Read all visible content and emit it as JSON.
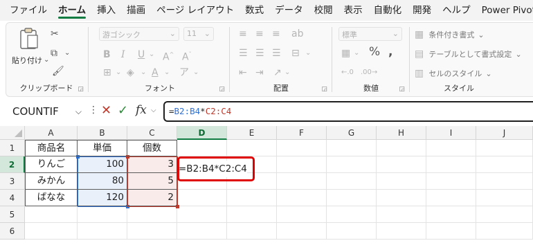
{
  "tabs": [
    "ファイル",
    "ホーム",
    "挿入",
    "描画",
    "ページ レイアウト",
    "数式",
    "データ",
    "校閲",
    "表示",
    "自動化",
    "開発",
    "ヘルプ",
    "Power Pivot"
  ],
  "ribbon": {
    "clipboard": {
      "label": "クリップボード",
      "paste": "貼り付け"
    },
    "font": {
      "label": "フォント",
      "font_name": "游ゴシック",
      "font_size": "11"
    },
    "alignment": {
      "label": "配置"
    },
    "number": {
      "label": "数値",
      "format": "標準"
    },
    "styles": {
      "label": "スタイル",
      "conditional": "条件付き書式",
      "table": "テーブルとして書式設定",
      "cell_styles": "セルのスタイル"
    }
  },
  "formula_bar": {
    "name_box": "COUNTIF",
    "formula_parts": [
      {
        "text": "=",
        "color": "plain"
      },
      {
        "text": "B2:B4",
        "color": "blue"
      },
      {
        "text": "*",
        "color": "plain"
      },
      {
        "text": "C2:C4",
        "color": "red"
      }
    ]
  },
  "grid": {
    "columns": [
      "A",
      "B",
      "C",
      "D",
      "E",
      "F",
      "G",
      "H",
      "I",
      "J"
    ],
    "rows": [
      "1",
      "2",
      "3",
      "4",
      "5",
      "6"
    ],
    "selected_column": "D",
    "selected_row": "2",
    "headers": [
      "商品名",
      "単価",
      "個数"
    ],
    "data": [
      [
        "りんご",
        "100",
        "3"
      ],
      [
        "みかん",
        "80",
        "5"
      ],
      [
        "ばなな",
        "120",
        "2"
      ]
    ],
    "editing_cell_text": "=B2:B4*C2:C4"
  },
  "colors": {
    "blue_ref": "#2f6fd1",
    "red_ref": "#c0392b",
    "accent": "#107c41",
    "annotation": "#e00000"
  }
}
